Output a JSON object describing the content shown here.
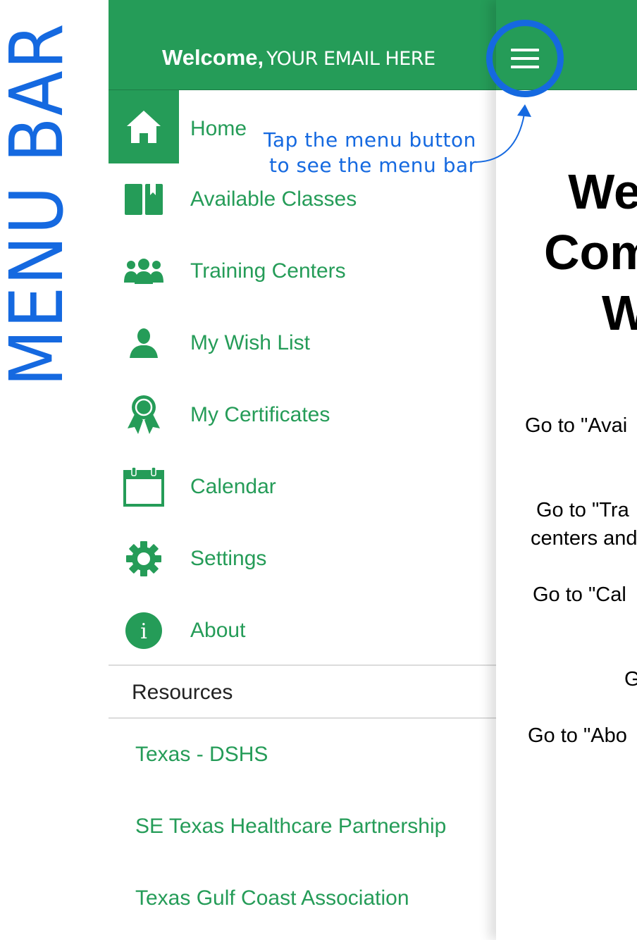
{
  "annotation": {
    "side_label": "MENU BAR",
    "tip_line1": "Tap the menu button",
    "tip_line2": "to see the menu bar",
    "color": "#1569e0"
  },
  "drawer": {
    "welcome_prefix": "Welcome,",
    "welcome_email": "YOUR EMAIL HERE",
    "nav_items": [
      {
        "label": "Home",
        "icon": "home-icon",
        "active": true
      },
      {
        "label": "Available Classes",
        "icon": "book-icon"
      },
      {
        "label": "Training Centers",
        "icon": "group-icon"
      },
      {
        "label": "My Wish List",
        "icon": "person-icon"
      },
      {
        "label": "My Certificates",
        "icon": "award-icon"
      },
      {
        "label": "Calendar",
        "icon": "calendar-icon"
      },
      {
        "label": "Settings",
        "icon": "gear-icon"
      },
      {
        "label": "About",
        "icon": "info-icon"
      }
    ],
    "resources_title": "Resources",
    "resources": [
      "Texas - DSHS",
      "SE Texas Healthcare Partnership",
      "Texas Gulf Coast Association"
    ]
  },
  "main": {
    "title_lines": [
      "We",
      "Com",
      "W"
    ],
    "text_lines": [
      "Go to \"Avai",
      "Go to \"Tra",
      "centers and",
      "Go to \"Cal",
      "G",
      "Go to \"Abo"
    ]
  },
  "colors": {
    "brand_green": "#259c58",
    "annotation_blue": "#1569e0"
  }
}
